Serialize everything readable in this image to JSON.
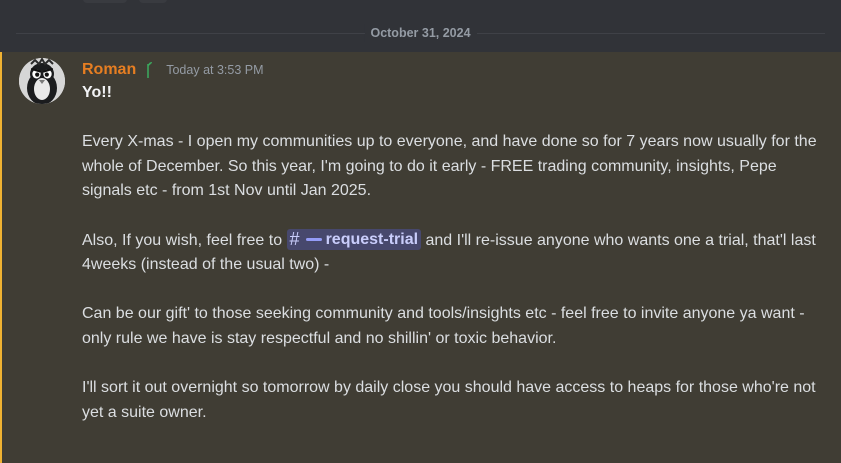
{
  "divider": {
    "date": "October 31, 2024"
  },
  "message": {
    "author": "Roman",
    "timestamp": "Today at 3:53 PM",
    "role_icon": "sprout-icon",
    "avatar": "penguin-avatar",
    "line1": "Yo!!",
    "para1": "Every X-mas - I open my communities up to everyone, and have done so for 7 years now usually for the whole of December. So this year, I'm going to do it early - FREE trading community, insights, Pepe signals etc - from 1st Nov until Jan 2025.",
    "para2_before": "Also, If you wish, feel free to ",
    "channel_mention": "request-trial",
    "para2_after": " and I'll re-issue anyone who wants one a trial, that'l last 4weeks (instead of the usual two) -",
    "para3": "Can be our gift' to those seeking community and tools/insights etc - feel free to invite anyone ya want - only rule we have is stay respectful and no shillin' or toxic behavior.",
    "para4": "I'll sort it out overnight so tomorrow by daily close you should have access to heaps for those who're not yet a suite owner."
  },
  "colors": {
    "background": "#313338",
    "highlight_background": "#403d34",
    "highlight_border": "#f0b232",
    "username": "#e67e22",
    "mention_text": "#c9cdfb"
  }
}
